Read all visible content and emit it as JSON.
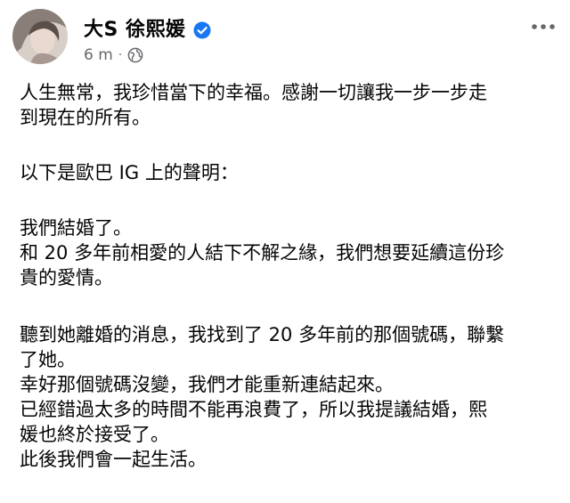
{
  "post": {
    "author_name": "大S 徐熙媛",
    "timestamp": "6 m",
    "separator": "·",
    "icons": {
      "verified": "verified-badge-icon",
      "audience": "globe-icon",
      "more": "more-options-icon"
    },
    "accent_color": "#1877f2",
    "meta_color": "#65676b",
    "lines": [
      "人生無常，我珍惜當下的幸福。感謝一切讓我一步一步走",
      "到現在的所有。",
      "以下是歐巴 IG 上的聲明：",
      "我們結婚了。",
      "和 20 多年前相愛的人結下不解之緣，我們想要延續這份珍",
      "貴的愛情。",
      "聽到她離婚的消息，我找到了 20 多年前的那個號碼，聯繫",
      "了她。",
      "幸好那個號碼沒變，我們才能重新連結起來。",
      "已經錯過太多的時間不能再浪費了，所以我提議結婚，熙",
      "媛也終於接受了。",
      "此後我們會一起生活。"
    ]
  }
}
